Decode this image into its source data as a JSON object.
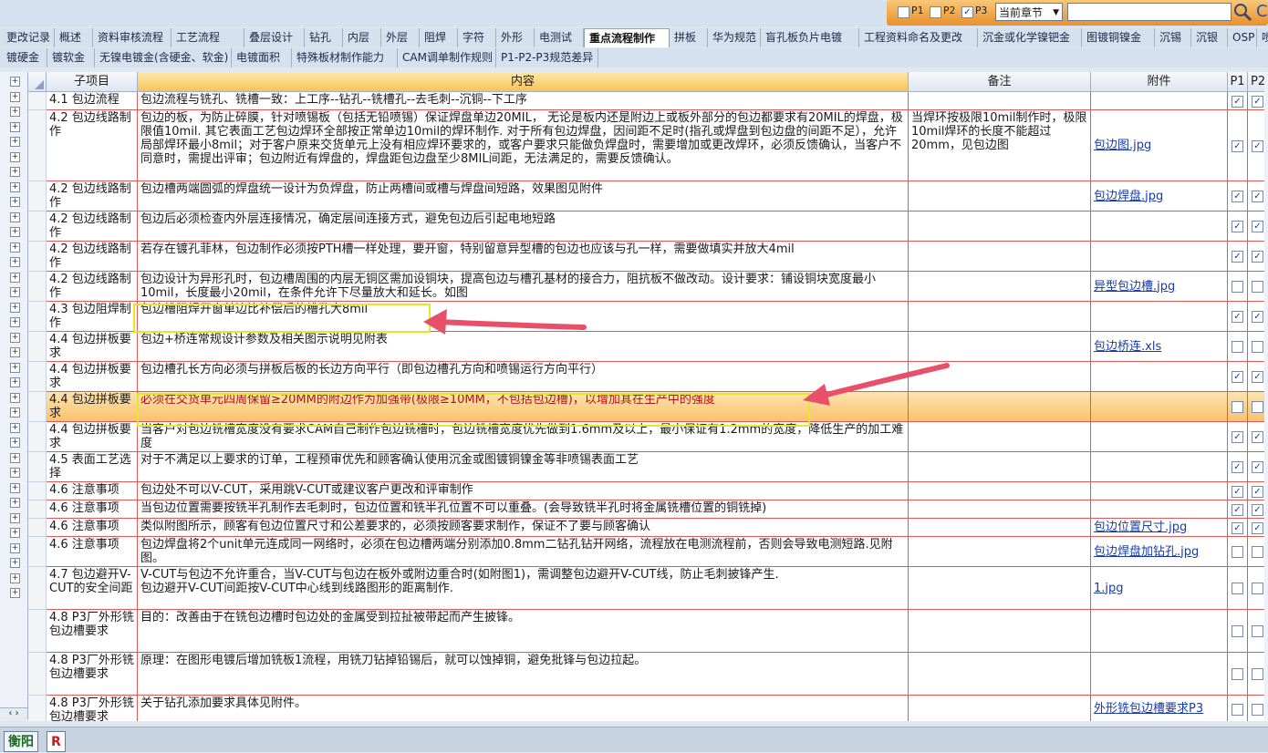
{
  "toolbar": {
    "filters": [
      {
        "label": "P1",
        "checked": false
      },
      {
        "label": "P2",
        "checked": false
      },
      {
        "label": "P3",
        "checked": true
      }
    ],
    "scope_select": "当前章节",
    "search_value": ""
  },
  "tabs_row1": [
    "更改记录",
    "概述",
    "资料审核流程",
    "工艺流程",
    "叠层设计",
    "钻孔",
    "内层",
    "外层",
    "阻焊",
    "字符",
    "外形",
    "电测试",
    "重点流程制作",
    "拼板",
    "华为规范",
    "盲孔板负片电镀",
    "工程资料命名及更改",
    "沉金或化学镍钯金",
    "图镀铜镍金",
    "沉锡",
    "沉银",
    "OSP",
    "喷锡"
  ],
  "active_tab": "重点流程制作",
  "tabs_row2": [
    "镀硬金",
    "镀软金",
    "无镍电镀金(含硬金、软金)",
    "电镀面积",
    "特殊板材制作能力",
    "CAM调单制作规则",
    "P1-P2-P3规范差异"
  ],
  "table": {
    "headers": {
      "sub": "子项目",
      "content": "内容",
      "note": "备注",
      "attach": "附件",
      "p1": "P1",
      "p2": "P2"
    },
    "rows": [
      {
        "sub": "4.1 包边流程",
        "content": "包边流程与铣孔、铣槽一致：上工序--钻孔--铣槽孔--去毛刺--沉铜--下工序",
        "note": "",
        "attach": "",
        "p1": true,
        "p2": true
      },
      {
        "sub": "4.2 包边线路制作",
        "content": "包边的板，为防止碎膜，针对喷锡板（包括无铅喷锡）保证焊盘单边20MIL， 无论是板内还是附边上或板外部分的包边都要求有20MIL的焊盘，极限值10mil. 其它表面工艺包边焊环全部按正常单边10mil的焊环制作. 对于所有包边焊盘，因间距不足时(指孔或焊盘到包边盘的间距不足），允许局部焊环最小8mil；对于客户原来交货单元上没有相应焊环要求的，或客户要求只能做负焊盘时，需要增加或更改焊环，必须反馈确认，当客户不同意时，需提出评审；包边附近有焊盘的，焊盘距包边盘至少8MIL间距，无法满足的，需要反馈确认。",
        "note": "当焊环按极限10mil制作时，极限10mil焊环的长度不能超过20mm，见包边图",
        "attach": "包边图.jpg",
        "p1": true,
        "p2": true
      },
      {
        "sub": "4.2 包边线路制作",
        "content": "包边槽两端圆弧的焊盘统一设计为负焊盘，防止两槽间或槽与焊盘间短路，效果图见附件",
        "note": "",
        "attach": "包边焊盘.jpg",
        "p1": true,
        "p2": true
      },
      {
        "sub": "4.2 包边线路制作",
        "content": "包边后必须检查内外层连接情况，确定层间连接方式，避免包边后引起电地短路",
        "note": "",
        "attach": "",
        "p1": true,
        "p2": true
      },
      {
        "sub": "4.2 包边线路制作",
        "content": "若存在镀孔菲林，包边制作必须按PTH槽一样处理，要开窗，特别留意异型槽的包边也应该与孔一样，需要做填实并放大4mil",
        "note": "",
        "attach": "",
        "p1": true,
        "p2": true
      },
      {
        "sub": "4.2 包边线路制作",
        "content": "包边设计为异形孔时，包边槽周围的内层无铜区需加设铜块，提高包边与槽孔基材的接合力，阻抗板不做改动。设计要求：铺设铜块宽度最小10mil，长度最小20mil，在条件允许下尽量放大和延长。如图",
        "note": "",
        "attach": "异型包边槽.jpg",
        "p1": false,
        "p2": false
      },
      {
        "sub": "4.3 包边阻焊制作",
        "content": "包边槽阻焊开窗单边比补偿后的槽孔大8mil",
        "note": "",
        "attach": "",
        "p1": true,
        "p2": true
      },
      {
        "sub": "4.4 包边拼板要求",
        "content": "包边+桥连常规设计参数及相关图示说明见附表",
        "note": "",
        "attach": "包边桥连.xls",
        "p1": false,
        "p2": false
      },
      {
        "sub": "4.4 包边拼板要求",
        "content": "包边槽孔长方向必须与拼板后板的长边方向平行（即包边槽孔方向和喷锡运行方向平行）",
        "note": "",
        "attach": "",
        "p1": true,
        "p2": true
      },
      {
        "sub": "4.4 包边拼板要求",
        "content": "必须在交货单元四周保留≥20MM的附边作为加强带(极限≥10MM，不包括包边槽)，以增加其在生产中的强度",
        "note": "",
        "attach": "",
        "p1": false,
        "p2": false
      },
      {
        "sub": "4.4 包边拼板要求",
        "content": "当客户对包边铣槽宽度没有要求CAM自己制作包边铣槽时，包边铣槽宽度优先做到1.6mm及以上，最小保证有1.2mm的宽度，降低生产的加工难度",
        "note": "",
        "attach": "",
        "p1": true,
        "p2": true
      },
      {
        "sub": "4.5 表面工艺选择",
        "content": "对于不满足以上要求的订单，工程预审优先和顾客确认使用沉金或图镀铜镍金等非喷锡表面工艺",
        "note": "",
        "attach": "",
        "p1": true,
        "p2": true
      },
      {
        "sub": "4.6 注意事项",
        "content": "包边处不可以V-CUT，采用跳V-CUT或建议客户更改和评审制作",
        "note": "",
        "attach": "",
        "p1": true,
        "p2": true
      },
      {
        "sub": "4.6 注意事项",
        "content": "当包边位置需要按铣半孔制作去毛刺时，包边位置和铣半孔位置不可以重叠。(会导致铣半孔时将金属铣槽位置的铜铣掉)",
        "note": "",
        "attach": "",
        "p1": true,
        "p2": true
      },
      {
        "sub": "4.6 注意事项",
        "content": "类似附图所示，顾客有包边位置尺寸和公差要求的，必须按顾客要求制作，保证不了要与顾客确认",
        "note": "",
        "attach": "包边位置尺寸.jpg",
        "p1": true,
        "p2": true
      },
      {
        "sub": "4.6 注意事项",
        "content": "包边焊盘将2个unit单元连成同一网络时，必须在包边槽两端分别添加0.8mm二钻孔钻开网络，流程放在电测流程前，否则会导致电测短路.见附图。",
        "note": "",
        "attach": "包边焊盘加钻孔.jpg",
        "p1": false,
        "p2": false
      },
      {
        "sub": "4.7 包边避开V-CUT的安全间距",
        "content": "V-CUT与包边不允许重合，当V-CUT与包边在板外或附边重合时(如附图1)，需调整包边避开V-CUT线，防止毛刺披锋产生.\n包边避开V-CUT间距按V-CUT中心线到线路图形的距离制作.",
        "note": "",
        "attach": "1.jpg",
        "p1": false,
        "p2": false
      },
      {
        "sub": "4.8 P3厂外形铣包边槽要求",
        "content": "目的：改善由于在铣包边槽时包边处的金属受到拉扯被带起而产生披锋。",
        "note": "",
        "attach": "",
        "p1": false,
        "p2": false
      },
      {
        "sub": "4.8 P3厂外形铣包边槽要求",
        "content": "原理：在图形电镀后增加铣板1流程，用铣刀钻掉铅锡后，就可以蚀掉铜，避免批锋与包边拉起。",
        "note": "",
        "attach": "",
        "p1": false,
        "p2": false
      },
      {
        "sub": "4.8 P3厂外形铣包边槽要求",
        "content": "关于钻孔添加要求具体见附件。",
        "note": "",
        "attach": "外形铣包边槽要求P3",
        "p1": false,
        "p2": false
      }
    ]
  },
  "bottom_tabs": [
    "衡阳",
    "R"
  ]
}
